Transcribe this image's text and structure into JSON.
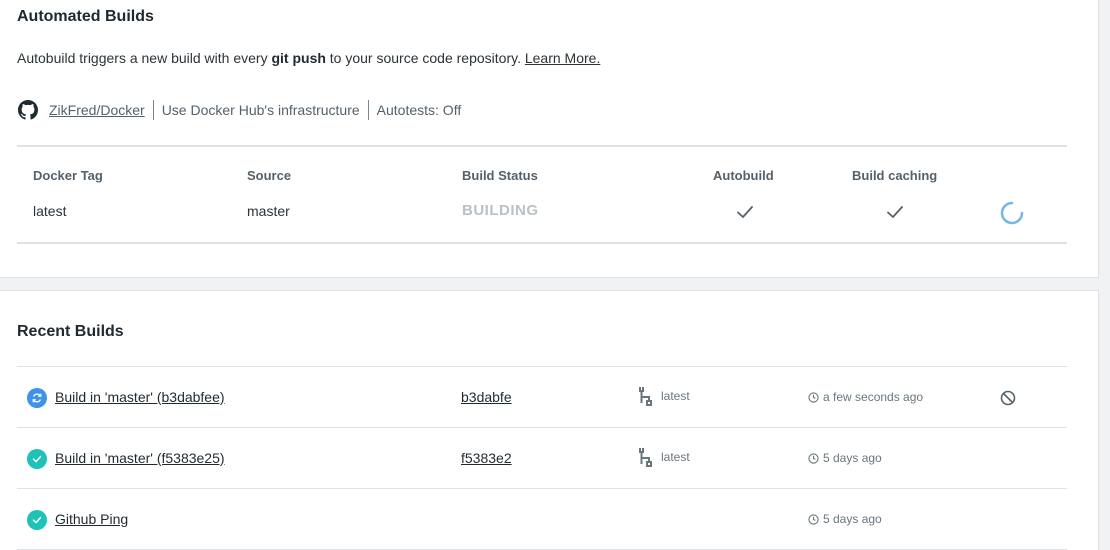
{
  "automated_builds": {
    "title": "Automated Builds",
    "description_prefix": "Autobuild triggers a new build with every ",
    "description_bold": "git push",
    "description_suffix": " to your source code repository. ",
    "learn_more": "Learn More.",
    "repo": "ZikFred/Docker",
    "infrastructure": "Use Docker Hub's infrastructure",
    "autotests": "Autotests: Off",
    "table": {
      "headers": {
        "docker_tag": "Docker Tag",
        "source": "Source",
        "build_status": "Build Status",
        "autobuild": "Autobuild",
        "build_caching": "Build caching"
      },
      "row": {
        "docker_tag": "latest",
        "source": "master",
        "build_status": "BUILDING",
        "autobuild_enabled": true,
        "build_caching_enabled": true
      }
    }
  },
  "recent_builds": {
    "title": "Recent Builds",
    "items": [
      {
        "name": "Build in 'master' (b3dabfee)",
        "commit": "b3dabfe",
        "tag": "latest",
        "time": "a few seconds ago",
        "status": "in-progress",
        "cancellable": true
      },
      {
        "name": "Build in 'master' (f5383e25)",
        "commit": "f5383e2",
        "tag": "latest",
        "time": "5 days ago",
        "status": "success",
        "cancellable": false
      },
      {
        "name": "Github Ping",
        "commit": "",
        "tag": "",
        "time": "5 days ago",
        "status": "success",
        "cancellable": false
      }
    ]
  },
  "colors": {
    "in_progress": "#3e92e8",
    "success": "#1ec2b7",
    "spinner": "#6fb8e8",
    "building_text": "#b8c1c6"
  }
}
